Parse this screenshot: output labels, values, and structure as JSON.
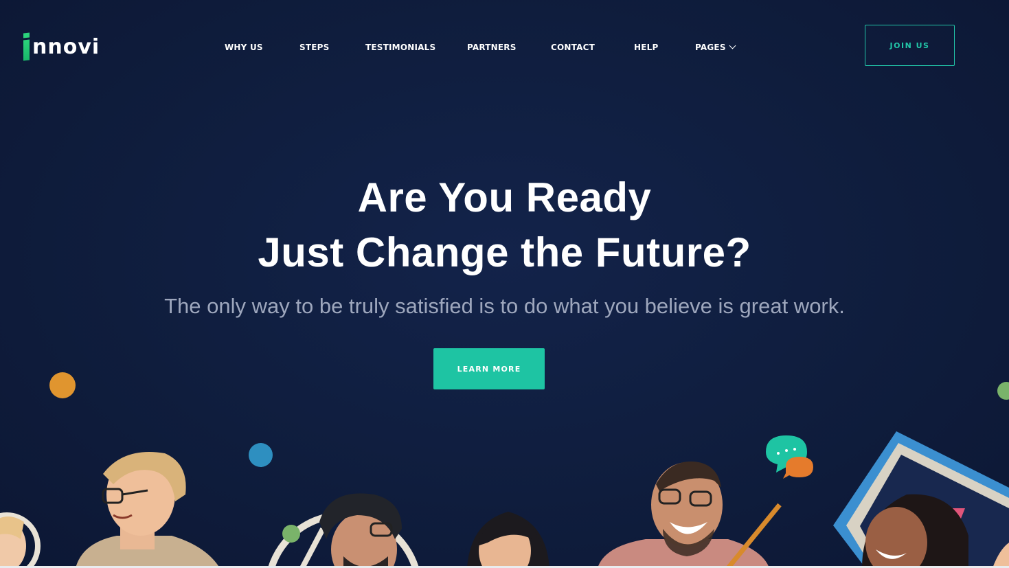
{
  "brand": {
    "logo_text": "nnovi",
    "logo_mark": "i-mark",
    "accent_color": "#1ec4a3",
    "logo_green": "#2bd27b",
    "background_color": "#0f1d3d"
  },
  "nav": {
    "items": [
      {
        "label": "WHY US"
      },
      {
        "label": "STEPS"
      },
      {
        "label": "TESTIMONIALS"
      },
      {
        "label": "PARTNERS"
      },
      {
        "label": "CONTACT"
      },
      {
        "label": "HELP"
      },
      {
        "label": "PAGES",
        "icon": "chevron-down-icon"
      }
    ],
    "cta_label": "JOIN US"
  },
  "hero": {
    "title_line1": "Are You Ready",
    "title_line2": "Just Change the Future?",
    "subtitle": "The only way to be truly satisfied is to do what you believe is great work.",
    "button_label": "LEARN MORE"
  },
  "decor": {
    "dot_colors": [
      "#e0952f",
      "#2e8fc0",
      "#7ab36a"
    ],
    "chat_bubble_colors": [
      "#1ec4a3",
      "#e57b2c"
    ],
    "frame_color": "#3b8fd0"
  }
}
